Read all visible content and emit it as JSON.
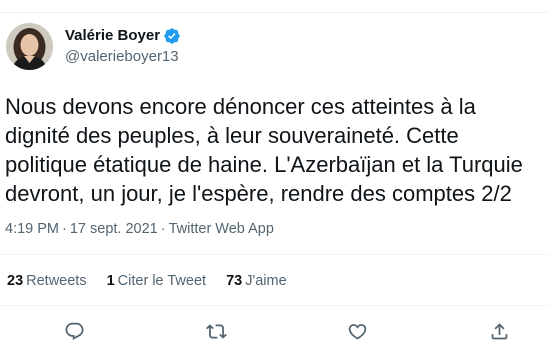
{
  "author": {
    "display_name": "Valérie Boyer",
    "handle": "@valerieboyer13",
    "verified": true
  },
  "tweet": {
    "text": "Nous devons encore dénoncer ces atteintes à la dignité des peuples, à leur souveraineté. Cette politique étatique de haine. L'Azerbaïjan et la Turquie devront, un jour, je l'espère, rendre des comptes 2/2",
    "time": "4:19 PM",
    "date": "17 sept. 2021",
    "source": "Twitter Web App"
  },
  "stats": {
    "retweets_count": "23",
    "retweets_label": "Retweets",
    "quotes_count": "1",
    "quotes_label": "Citer le Tweet",
    "likes_count": "73",
    "likes_label": "J'aime"
  },
  "actions": {
    "icons": [
      "reply-icon",
      "retweet-icon",
      "like-icon",
      "share-icon"
    ]
  },
  "colors": {
    "verified": "#1d9bf0",
    "secondary_text": "#536471",
    "divider": "#eff3f4"
  }
}
